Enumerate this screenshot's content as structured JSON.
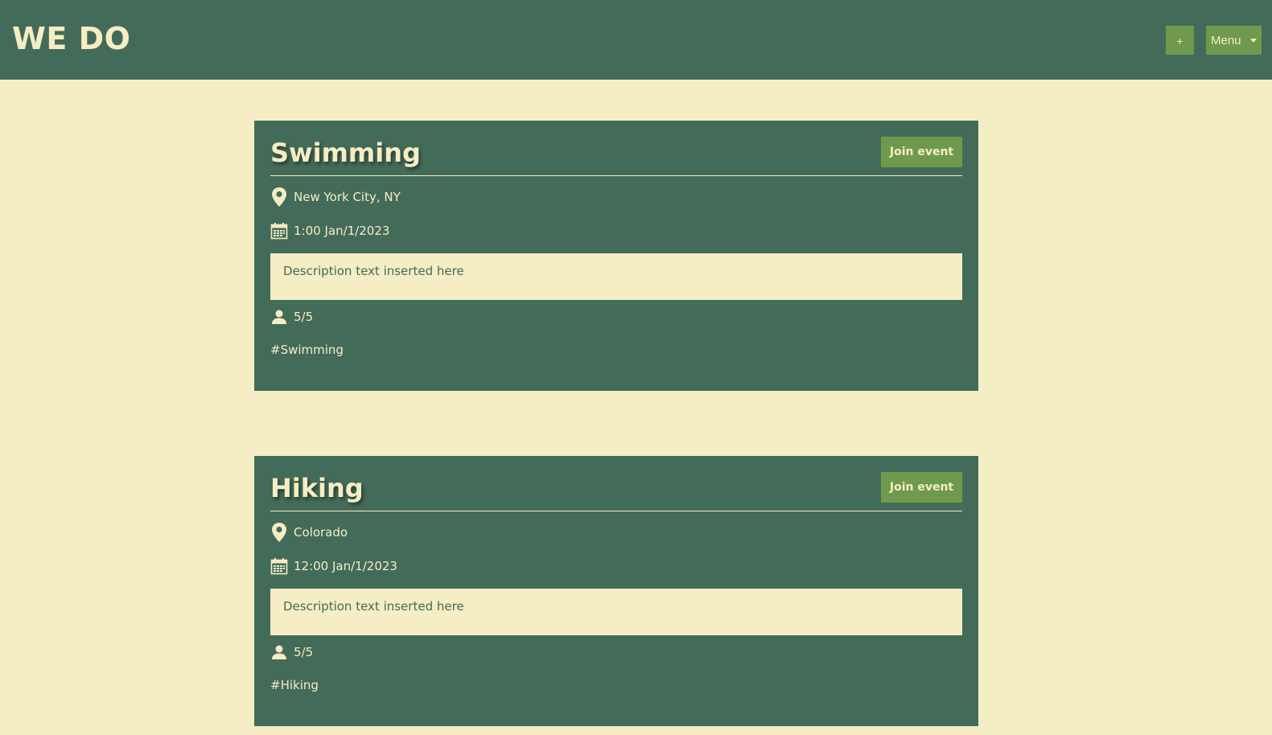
{
  "header": {
    "brand": "WE DO",
    "add_label": "+",
    "menu_label": "Menu"
  },
  "events": [
    {
      "title": "Swimming",
      "join_label": "Join event",
      "location": "New York City, NY",
      "datetime": "1:00 Jan/1/2023",
      "description": "Description text inserted here",
      "participants": "5/5",
      "tag": "#Swimming"
    },
    {
      "title": "Hiking",
      "join_label": "Join event",
      "location": "Colorado",
      "datetime": "12:00 Jan/1/2023",
      "description": "Description text inserted here",
      "participants": "5/5",
      "tag": "#Hiking"
    }
  ],
  "colors": {
    "background": "#f5edc4",
    "primary": "#436b59",
    "accent": "#6f9a4e"
  },
  "icons": [
    "location-pin-icon",
    "calendar-icon",
    "person-icon",
    "chevron-down-icon"
  ]
}
